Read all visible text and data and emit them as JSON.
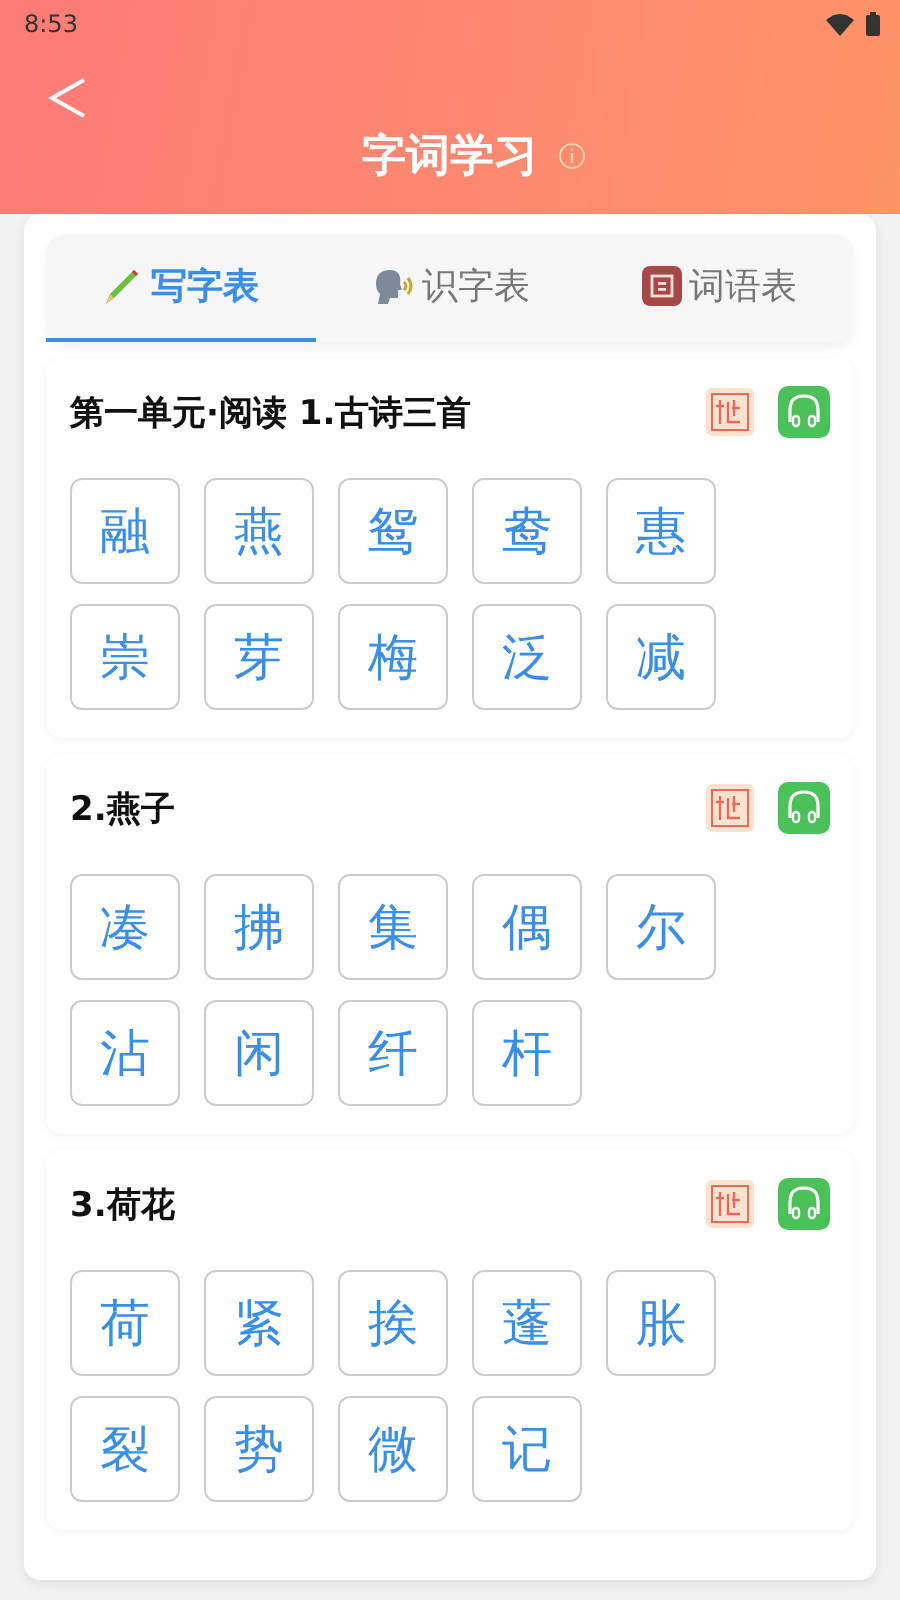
{
  "status_bar": {
    "time": "8:53"
  },
  "header": {
    "title": "字词学习"
  },
  "tabs": [
    {
      "label": "写字表",
      "kind": "pencil",
      "selected": true
    },
    {
      "label": "识字表",
      "kind": "speaker",
      "selected": false
    },
    {
      "label": "词语表",
      "kind": "book",
      "selected": false
    }
  ],
  "sections": [
    {
      "title": "第一单元·阅读 1.古诗三首",
      "characters": [
        "融",
        "燕",
        "鸳",
        "鸯",
        "惠",
        "崇",
        "芽",
        "梅",
        "泛",
        "减"
      ]
    },
    {
      "title": "2.燕子",
      "characters": [
        "凑",
        "拂",
        "集",
        "偶",
        "尔",
        "沾",
        "闲",
        "纤",
        "杆"
      ]
    },
    {
      "title": "3.荷花",
      "characters": [
        "荷",
        "紧",
        "挨",
        "蓬",
        "胀",
        "裂",
        "势",
        "微",
        "记"
      ]
    }
  ]
}
